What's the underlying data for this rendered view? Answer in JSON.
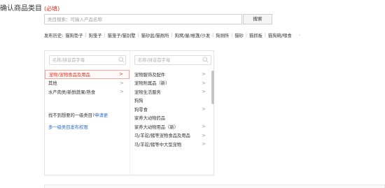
{
  "title": {
    "text": "确认商品类目",
    "required": "(必填)"
  },
  "search": {
    "placeholder": "类目搜索：可输入产品名称",
    "button_label": "搜索"
  },
  "history": {
    "label": "发布历史:",
    "items": [
      "猫狗垫子",
      "狗笼子",
      "猫笼子/猫别墅",
      "猫砂盆/猫厕所",
      "狗窝/屋/帐篷/沙发",
      "狗厕所",
      "猫砂",
      "猫抓板",
      "猫狗碗/喂食"
    ],
    "arrow": "›"
  },
  "column1": {
    "search_placeholder": "名称/拼音首字母",
    "items": [
      {
        "label": "宠物/宠物食品及用品",
        "selected": true,
        "has_children": true
      },
      {
        "label": "其他",
        "selected": false,
        "has_children": true
      },
      {
        "label": "水产肉类/新鲜蔬果/熟食",
        "selected": false,
        "has_children": true
      }
    ],
    "not_found_text": "找不到想要的一级类目?",
    "apply_link": "申请更",
    "permission_link": "多一级类目发布权限"
  },
  "column2": {
    "search_placeholder": "名称/拼音首字母",
    "items": [
      {
        "label": "宠物服饰及配件",
        "has_children": true
      },
      {
        "label": "宠物附属品（新）",
        "has_children": true
      },
      {
        "label": "宠物生活服务",
        "has_children": true
      },
      {
        "label": "狗狗",
        "has_children": false
      },
      {
        "label": "狗零食",
        "has_children": true
      },
      {
        "label": "家养大动物药品",
        "has_children": false
      },
      {
        "label": "家养大动物用品（新）",
        "has_children": true
      },
      {
        "label": "马/羊驼/猪等宠物食品及用品",
        "has_children": true
      },
      {
        "label": "马/羊驼/猪等中大型宠物",
        "has_children": true
      }
    ]
  },
  "icons": {
    "chevron": "chevron-right-icon",
    "search": "search-icon"
  },
  "colors": {
    "accent": "#e0301e",
    "link": "#2d6bd4",
    "border": "#e2e2e2"
  }
}
